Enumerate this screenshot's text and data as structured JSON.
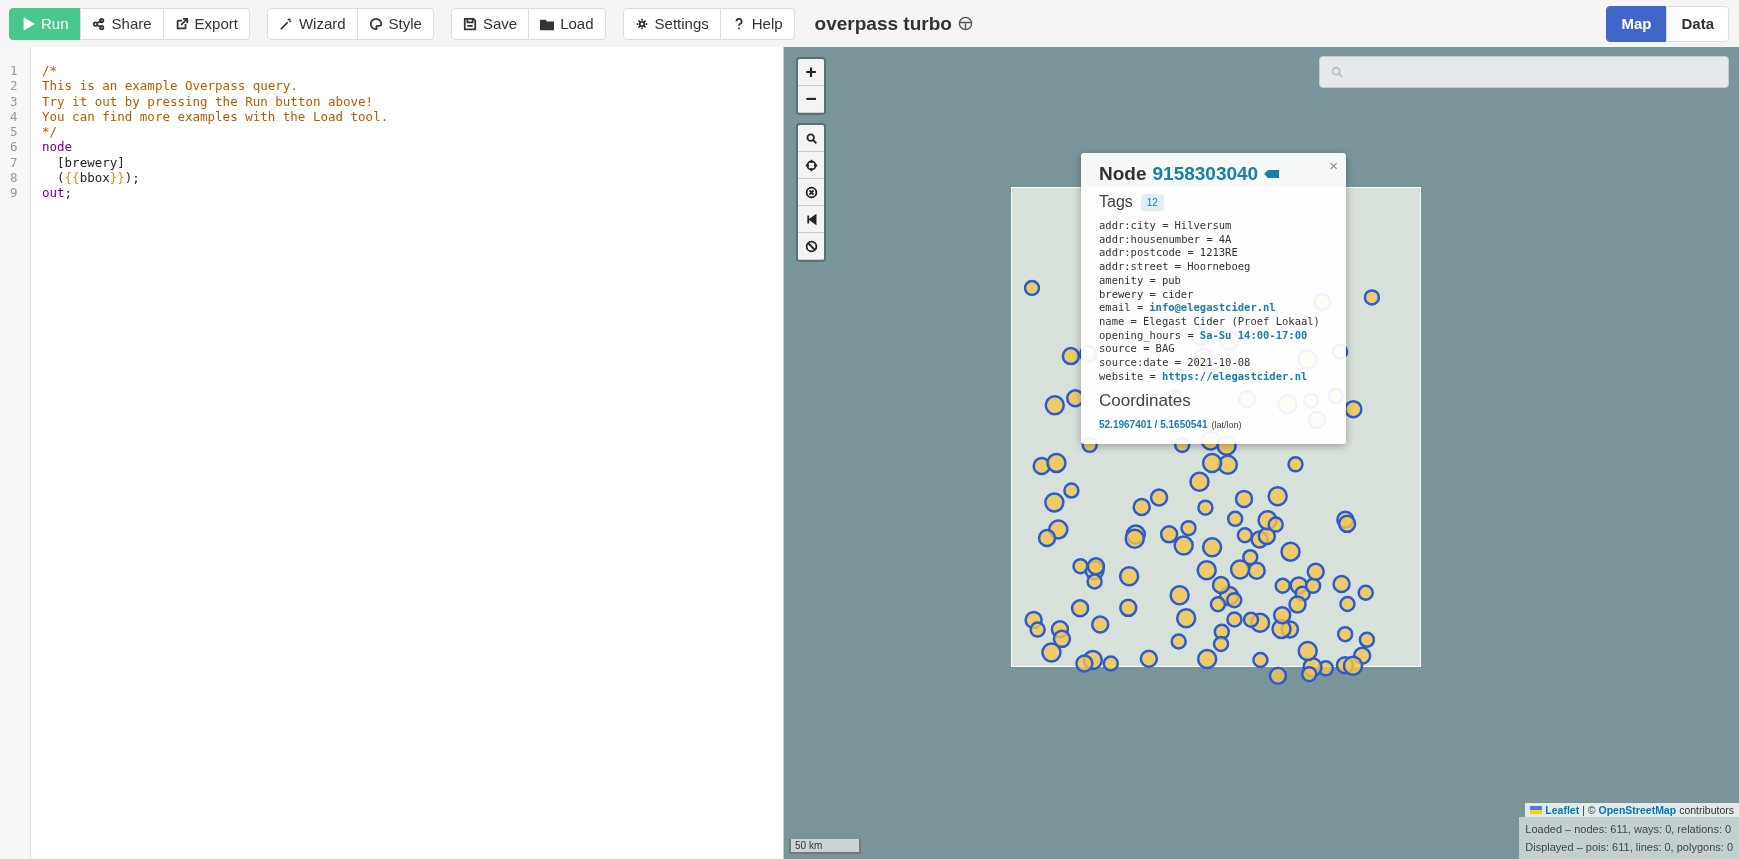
{
  "toolbar": {
    "groups": [
      [
        {
          "label": "Run",
          "primary": true
        },
        {
          "label": "Share",
          "primary": false
        },
        {
          "label": "Export",
          "primary": false
        }
      ],
      [
        {
          "label": "Wizard",
          "primary": false
        },
        {
          "label": "Style",
          "primary": false
        }
      ],
      [
        {
          "label": "Save",
          "primary": false
        },
        {
          "label": "Load",
          "primary": false
        }
      ],
      [
        {
          "label": "Settings",
          "primary": false
        },
        {
          "label": "Help",
          "primary": false
        }
      ]
    ],
    "title": "overpass turbo"
  },
  "view_toggle": [
    {
      "label": "Map",
      "selected": true
    },
    {
      "label": "Data",
      "selected": false
    }
  ],
  "editor": {
    "lines": [
      {
        "number": "1",
        "tokens": [
          {
            "kind": "comment",
            "text": "/*"
          }
        ]
      },
      {
        "number": "2",
        "tokens": [
          {
            "kind": "comment",
            "text": "This is an example Overpass query."
          }
        ]
      },
      {
        "number": "3",
        "tokens": [
          {
            "kind": "comment",
            "text": "Try it out by pressing the Run button above!"
          }
        ]
      },
      {
        "number": "4",
        "tokens": [
          {
            "kind": "comment",
            "text": "You can find more examples with the Load tool."
          }
        ]
      },
      {
        "number": "5",
        "tokens": [
          {
            "kind": "comment",
            "text": "*/"
          }
        ]
      },
      {
        "number": "6",
        "tokens": [
          {
            "kind": "keyword",
            "text": "node"
          }
        ]
      },
      {
        "number": "7",
        "tokens": [
          {
            "kind": "plain",
            "text": "  [brewery]"
          }
        ]
      },
      {
        "number": "8",
        "tokens": [
          {
            "kind": "plain",
            "text": "  ("
          },
          {
            "kind": "template",
            "text": "{{"
          },
          {
            "kind": "plain",
            "text": "bbox"
          },
          {
            "kind": "template",
            "text": "}}"
          },
          {
            "kind": "plain",
            "text": ");"
          }
        ]
      },
      {
        "number": "9",
        "tokens": [
          {
            "kind": "keyword",
            "text": "out"
          },
          {
            "kind": "plain",
            "text": ";"
          }
        ]
      }
    ]
  },
  "map": {
    "zoom_controls": [
      {
        "label": "+"
      },
      {
        "label": "−"
      }
    ],
    "popup": {
      "type": "Node",
      "id": "9158303040",
      "tags_heading": "Tags",
      "tag_count": "12",
      "tags": [
        {
          "key": "addr:city =",
          "value": "Hilversum",
          "link": false
        },
        {
          "key": "addr:housenumber =",
          "value": "4A",
          "link": false
        },
        {
          "key": "addr:postcode =",
          "value": "1213RE",
          "link": false
        },
        {
          "key": "addr:street =",
          "value": "Hoorneboeg",
          "link": false
        },
        {
          "key": "amenity =",
          "value": "pub",
          "link": false
        },
        {
          "key": "brewery =",
          "value": "cider",
          "link": false
        },
        {
          "key": "email =",
          "value": "info@elegastcider.nl",
          "link": true
        },
        {
          "key": "name =",
          "value": "Elegast Cider (Proef Lokaal)",
          "link": false
        },
        {
          "key": "opening_hours =",
          "value": "Sa-Su 14:00-17:00",
          "link": true
        },
        {
          "key": "source =",
          "value": "BAG",
          "link": false
        },
        {
          "key": "source:date =",
          "value": "2021-10-08",
          "link": false
        },
        {
          "key": "website =",
          "value": "https://elegastcider.nl",
          "link": true
        }
      ],
      "coords_heading": "Coordinates",
      "coords": "52.1967401 / 5.1650541",
      "coords_unit": "(lat/lon)",
      "close": "×"
    },
    "scale": "50 km",
    "attribution": {
      "leaflet": "Leaflet",
      "separator": "| ©",
      "osm": "OpenStreetMap",
      "suffix": "contributors"
    },
    "stats": [
      "Loaded – nodes: 611, ways: 0, relations: 0",
      "Displayed – pois: 611, lines: 0, polygons: 0"
    ]
  }
}
